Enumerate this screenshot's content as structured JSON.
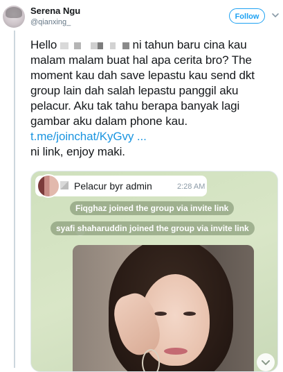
{
  "tweet": {
    "author": {
      "display_name": "Serena Ngu",
      "handle": "@qianxing_"
    },
    "follow_label": "Follow",
    "text": {
      "line1_start": "Hello",
      "line1_end": "ni tahun baru cina kau malam malam buat hal apa cerita bro? The moment kau dah save lepastu kau send dkt group lain dah salah lepastu panggil aku pelacur. Aku tak tahu berapa banyak lagi gambar aku dalam phone kau.",
      "link": "t.me/joinchat/KyGvy ...",
      "line_end": "ni link, enjoy maki."
    }
  },
  "chat": {
    "group_name": "Pelacur byr admin",
    "time": "2:28 AM",
    "system_messages": [
      "Fiqghaz joined the group via invite link",
      "syafi shaharuddin joined the group via invite link"
    ]
  },
  "colors": {
    "link": "#1b95e0",
    "follow": "#1da1f2"
  }
}
